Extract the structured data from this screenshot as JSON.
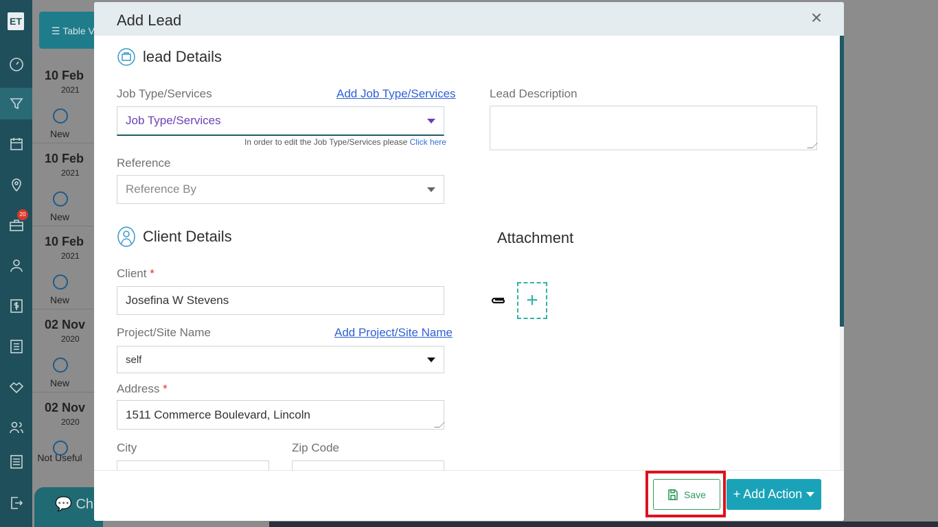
{
  "app": {
    "logo_text": "ET",
    "notification_count": "20",
    "sidebar_icons": [
      "dashboard-icon",
      "funnel-icon",
      "calendar-icon",
      "map-pin-icon",
      "briefcase-icon",
      "user-icon",
      "dollar-icon",
      "list-icon",
      "handshake-icon",
      "users-icon",
      "settings-sliders-icon",
      "logout-icon"
    ]
  },
  "background": {
    "table_view_label": "Table V",
    "chat_label": "Ch",
    "items": [
      {
        "date": "10 Feb",
        "year": "2021",
        "status": "New"
      },
      {
        "date": "10 Feb",
        "year": "2021",
        "status": "New"
      },
      {
        "date": "10 Feb",
        "year": "2021",
        "status": "New"
      },
      {
        "date": "02 Nov",
        "year": "2020",
        "status": "New"
      },
      {
        "date": "02 Nov",
        "year": "2020",
        "status": "Not Useful"
      }
    ]
  },
  "modal": {
    "title": "Add Lead",
    "lead_section": {
      "title": "lead Details",
      "job_type_label": "Job Type/Services",
      "add_job_type_link": "Add Job Type/Services",
      "job_type_value": "Job Type/Services",
      "job_type_hint": "In order to edit the Job Type/Services please",
      "job_type_hint_link": "Click here",
      "reference_label": "Reference",
      "reference_placeholder": "Reference By",
      "description_label": "Lead Description",
      "description_value": ""
    },
    "client_section": {
      "title": "Client Details",
      "client_label": "Client",
      "required_mark": "*",
      "client_value": "Josefina W Stevens",
      "project_label": "Project/Site Name",
      "add_project_link": "Add Project/Site Name",
      "project_value": "self",
      "address_label": "Address",
      "address_value": "1511  Commerce Boulevard, Lincoln",
      "city_label": "City",
      "zip_label": "Zip Code"
    },
    "attachment": {
      "title": "Attachment",
      "add_symbol": "+"
    },
    "footer": {
      "save_label": "Save",
      "add_action_label": "+ Add Action"
    }
  }
}
